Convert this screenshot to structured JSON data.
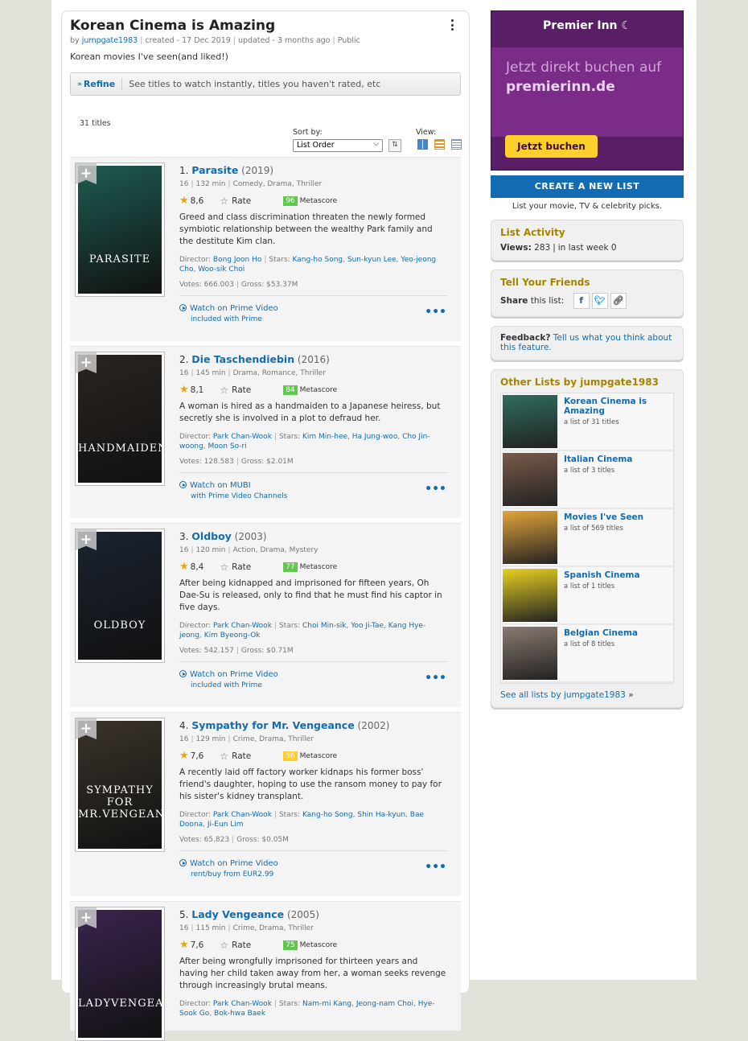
{
  "list": {
    "title": "Korean Cinema is Amazing",
    "by_label": "by",
    "author": "jumpgate1983",
    "created": "created - 17 Dec 2019",
    "updated": "updated - 3 months ago",
    "visibility": "Public",
    "description": "Korean movies I've seen(and liked!)"
  },
  "refine": {
    "button": "Refine",
    "text": "See titles to watch instantly, titles you haven't rated, etc"
  },
  "toolbar": {
    "count": "31 titles",
    "sort_label": "Sort by:",
    "sort_value": "List Order",
    "view_label": "View:"
  },
  "items": [
    {
      "rank": "1.",
      "title": "Parasite",
      "year": "(2019)",
      "cert": "16",
      "runtime": "132 min",
      "genres": "Comedy, Drama, Thriller",
      "rating": "8,6",
      "rate_label": "Rate",
      "metascore": "96",
      "metascore_label": "Metascore",
      "plot": "Greed and class discrimination threaten the newly formed symbiotic relationship between the wealthy Park family and the destitute Kim clan.",
      "director_label": "Director:",
      "directors": [
        "Bong Joon Ho"
      ],
      "stars_label": "Stars:",
      "stars": [
        "Kang-ho Song",
        "Sun-kyun Lee",
        "Yeo-jeong Cho",
        "Woo-sik Choi"
      ],
      "votes": "Votes: 666.003",
      "gross": "Gross: $53.37M",
      "watch": "Watch on Prime Video",
      "watch_sub": "included with Prime",
      "poster_text": "PARASITE",
      "poster_color": "#1e5b52",
      "ms_color": "green"
    },
    {
      "rank": "2.",
      "title": "Die Taschendiebin",
      "year": "(2016)",
      "cert": "16",
      "runtime": "145 min",
      "genres": "Drama, Romance, Thriller",
      "rating": "8,1",
      "rate_label": "Rate",
      "metascore": "84",
      "metascore_label": "Metascore",
      "plot": "A woman is hired as a handmaiden to a Japanese heiress, but secretly she is involved in a plot to defraud her.",
      "director_label": "Director:",
      "directors": [
        "Park Chan-Wook"
      ],
      "stars_label": "Stars:",
      "stars": [
        "Kim Min-hee",
        "Ha Jung-woo",
        "Cho Jin-woong",
        "Moon So-ri"
      ],
      "votes": "Votes: 128.583",
      "gross": "Gross: $2.01M",
      "watch": "Watch on MUBI",
      "watch_sub": "with Prime Video Channels",
      "poster_text": "HANDMAIDEN",
      "poster_color": "#2a2420",
      "ms_color": "green"
    },
    {
      "rank": "3.",
      "title": "Oldboy",
      "year": "(2003)",
      "cert": "16",
      "runtime": "120 min",
      "genres": "Action, Drama, Mystery",
      "rating": "8,4",
      "rate_label": "Rate",
      "metascore": "77",
      "metascore_label": "Metascore",
      "plot": "After being kidnapped and imprisoned for fifteen years, Oh Dae-Su is released, only to find that he must find his captor in five days.",
      "director_label": "Director:",
      "directors": [
        "Park Chan-Wook"
      ],
      "stars_label": "Stars:",
      "stars": [
        "Choi Min-sik",
        "Yoo Ji-Tae",
        "Kang Hye-jeong",
        "Kim Byeong-Ok"
      ],
      "votes": "Votes: 542.157",
      "gross": "Gross: $0.71M",
      "watch": "Watch on Prime Video",
      "watch_sub": "included with Prime",
      "poster_text": "OLDBOY",
      "poster_color": "#1a2330",
      "ms_color": "green"
    },
    {
      "rank": "4.",
      "title": "Sympathy for Mr. Vengeance",
      "year": "(2002)",
      "cert": "16",
      "runtime": "129 min",
      "genres": "Crime, Drama, Thriller",
      "rating": "7,6",
      "rate_label": "Rate",
      "metascore": "56",
      "metascore_label": "Metascore",
      "plot": "A recently laid off factory worker kidnaps his former boss' friend's daughter, hoping to use the ransom money to pay for his sister's kidney transplant.",
      "director_label": "Director:",
      "directors": [
        "Park Chan-Wook"
      ],
      "stars_label": "Stars:",
      "stars": [
        "Kang-ho Song",
        "Shin Ha-kyun",
        "Bae Doona",
        "Ji-Eun Lim"
      ],
      "votes": "Votes: 65.823",
      "gross": "Gross: $0.05M",
      "watch": "Watch on Prime Video",
      "watch_sub": "rent/buy from EUR2.99",
      "poster_text": "SYMPATHY FOR MR.VENGEANCE",
      "poster_color": "#3a342a",
      "ms_color": "yellow"
    },
    {
      "rank": "5.",
      "title": "Lady Vengeance",
      "year": "(2005)",
      "cert": "16",
      "runtime": "115 min",
      "genres": "Crime, Drama, Thriller",
      "rating": "7,6",
      "rate_label": "Rate",
      "metascore": "75",
      "metascore_label": "Metascore",
      "plot": "After being wrongfully imprisoned for thirteen years and having her child taken away from her, a woman seeks revenge through increasingly brutal means.",
      "director_label": "Director:",
      "directors": [
        "Park Chan-Wook"
      ],
      "stars_label": "Stars:",
      "stars": [
        "Nam-mi Kang",
        "Jeong-nam Choi",
        "Hye-Sook Go",
        "Bok-hwa Baek"
      ],
      "votes": "",
      "gross": "",
      "watch": "",
      "watch_sub": "",
      "poster_text": "LADYVENGEANCE",
      "poster_color": "#3a2450",
      "ms_color": "green"
    }
  ],
  "ad": {
    "brand": "Premier Inn",
    "headline_1": "Jetzt direkt buchen auf",
    "headline_2": "premierinn.de",
    "cta": "Jetzt buchen"
  },
  "sidebar": {
    "create_button": "CREATE A NEW LIST",
    "create_sub": "List your movie, TV & celebrity picks.",
    "activity_title": "List Activity",
    "views_label": "Views:",
    "views_value": "283",
    "views_week": "in last week 0",
    "tell_title": "Tell Your Friends",
    "share_label": "Share",
    "share_rest": "this list:",
    "feedback_label": "Feedback?",
    "feedback_link": "Tell us what you think about this feature.",
    "other_title": "Other Lists by jumpgate1983",
    "other_lists": [
      {
        "name": "Korean Cinema is Amazing",
        "count": "a list of 31 titles",
        "color": "#2f6d5e"
      },
      {
        "name": "Italian Cinema",
        "count": "a list of 3 titles",
        "color": "#7a5a4a"
      },
      {
        "name": "Movies I've Seen",
        "count": "a list of 569 titles",
        "color": "#e3a43a"
      },
      {
        "name": "Spanish Cinema",
        "count": "a list of 1 titles",
        "color": "#e8d020"
      },
      {
        "name": "Belgian Cinema",
        "count": "a list of 8 titles",
        "color": "#8a7a70"
      }
    ],
    "see_all": "See all lists by jumpgate1983",
    "see_all_arrow": "»"
  }
}
